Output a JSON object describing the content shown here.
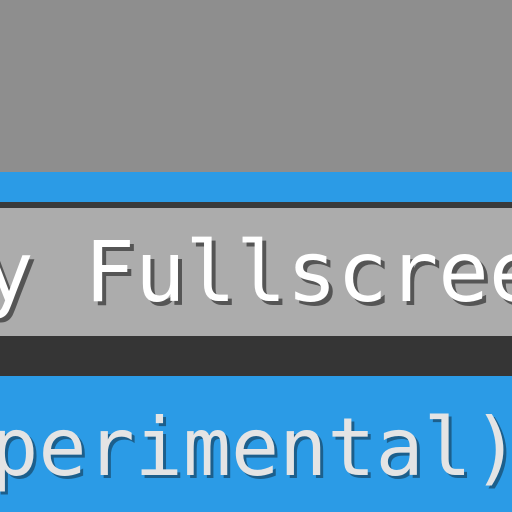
{
  "window": {
    "title": ""
  },
  "option": {
    "label": "ry Fullscreen"
  },
  "note": {
    "text": "experimental)"
  },
  "colors": {
    "top_panel": "#8e8e8e",
    "accent_blue": "#2b9be6",
    "button_bg": "#acacac",
    "dark_band": "#353535",
    "label_text": "#ffffff",
    "note_text": "#e4e4e4"
  }
}
